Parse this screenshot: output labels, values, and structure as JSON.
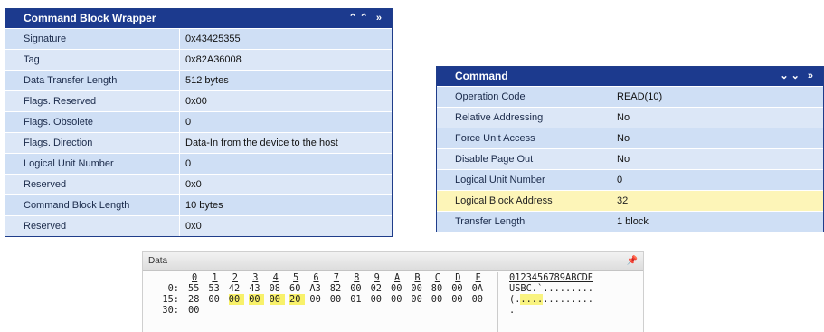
{
  "cbw": {
    "title": "Command Block Wrapper",
    "controls": "» »",
    "rows": [
      {
        "k": "Signature",
        "v": "0x43425355"
      },
      {
        "k": "Tag",
        "v": "0x82A36008"
      },
      {
        "k": "Data Transfer Length",
        "v": "512 bytes"
      },
      {
        "k": "Flags. Reserved",
        "v": "0x00"
      },
      {
        "k": "Flags. Obsolete",
        "v": "0"
      },
      {
        "k": "Flags. Direction",
        "v": "Data-In from the device to the host"
      },
      {
        "k": "Logical Unit Number",
        "v": "0"
      },
      {
        "k": "Reserved",
        "v": "0x0"
      },
      {
        "k": "Command Block Length",
        "v": "10 bytes"
      },
      {
        "k": "Reserved",
        "v": "0x0"
      }
    ]
  },
  "cmd": {
    "title": "Command",
    "controls": "» »",
    "rows": [
      {
        "k": "Operation Code",
        "v": "READ(10)"
      },
      {
        "k": "Relative Addressing",
        "v": "No"
      },
      {
        "k": "Force Unit Access",
        "v": "No"
      },
      {
        "k": "Disable Page Out",
        "v": "No"
      },
      {
        "k": "Logical Unit Number",
        "v": "0"
      },
      {
        "k": "Logical Block Address",
        "v": "32"
      },
      {
        "k": "Transfer Length",
        "v": "1 block"
      }
    ]
  },
  "hex": {
    "title": "Data",
    "pin": "q",
    "header_hex": [
      "0",
      "1",
      "2",
      "3",
      "4",
      "5",
      "6",
      "7",
      "8",
      "9",
      "A",
      "B",
      "C",
      "D",
      "E"
    ],
    "header_ascii": "0123456789ABCDE",
    "lines": [
      {
        "addr": "0:",
        "bytes": [
          "55",
          "53",
          "42",
          "43",
          "08",
          "60",
          "A3",
          "82",
          "00",
          "02",
          "00",
          "00",
          "80",
          "00",
          "0A"
        ],
        "ascii": "USBC.`........."
      },
      {
        "addr": "15:",
        "bytes": [
          "28",
          "00",
          "00",
          "00",
          "00",
          "20",
          "00",
          "00",
          "01",
          "00",
          "00",
          "00",
          "00",
          "00",
          "00"
        ],
        "ascii": "(.............."
      },
      {
        "addr": "30:",
        "bytes": [
          "00"
        ],
        "ascii": "."
      }
    ],
    "highlight": {
      "line": 1,
      "from": 2,
      "to": 5
    }
  }
}
